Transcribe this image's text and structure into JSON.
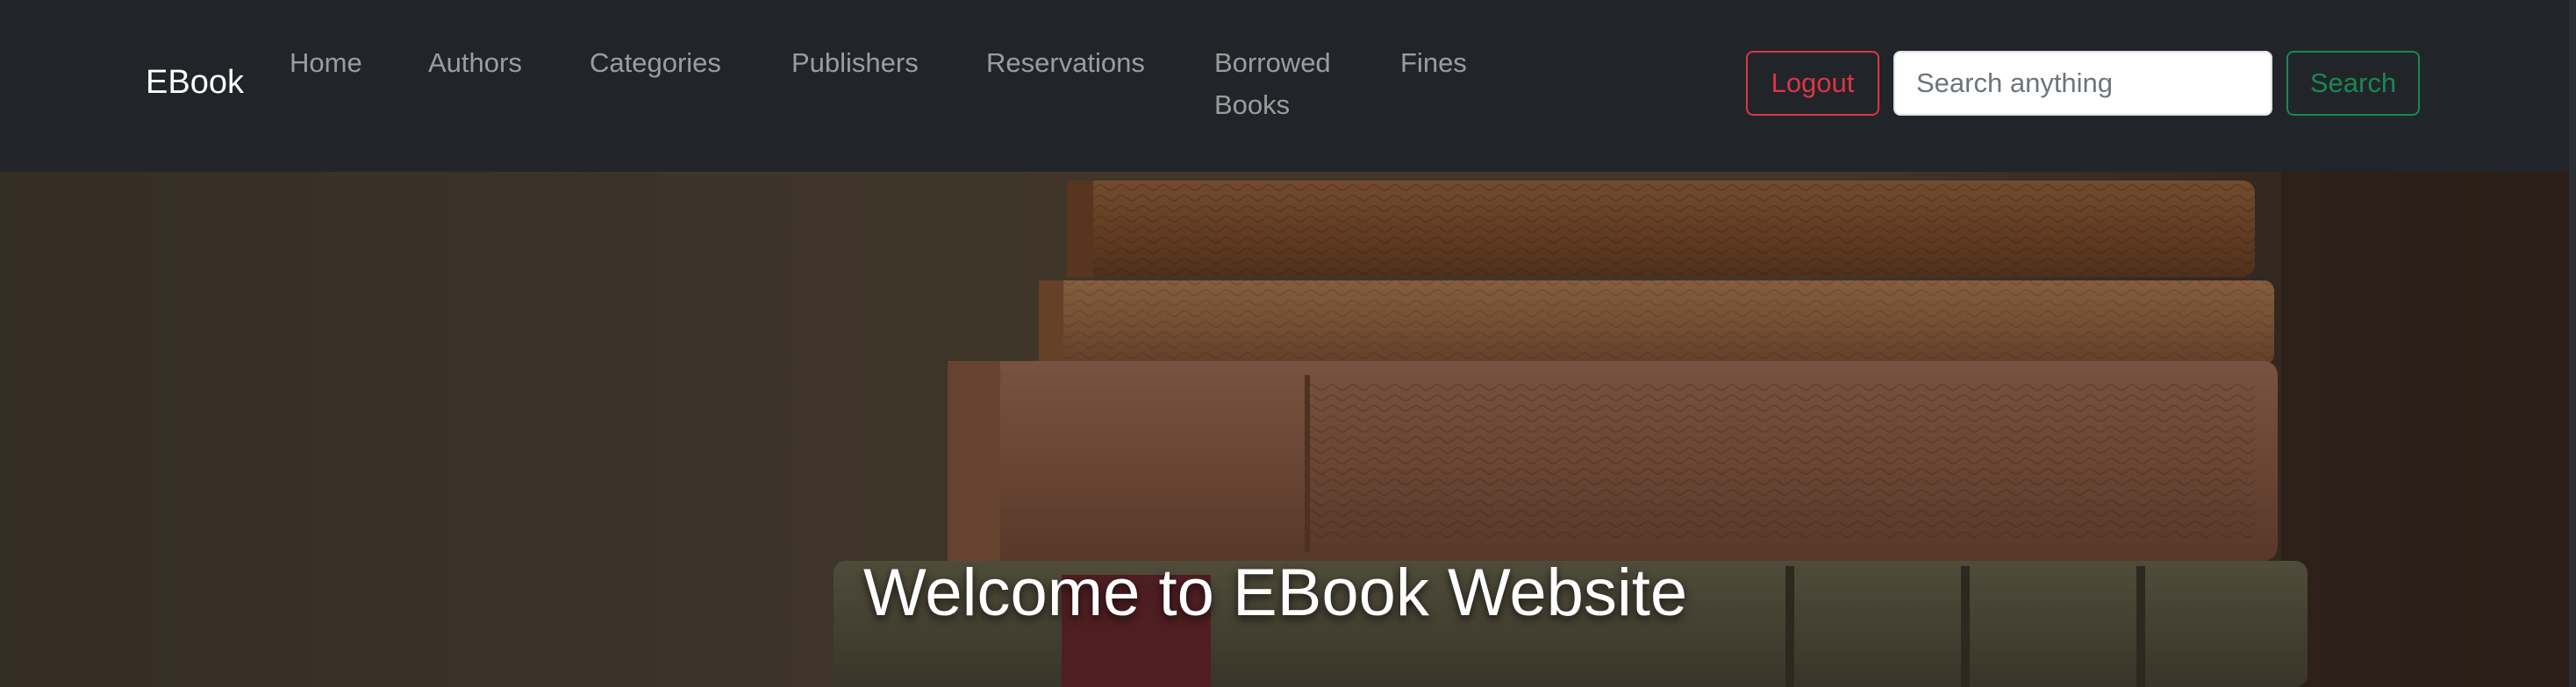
{
  "navbar": {
    "brand": "EBook",
    "links": [
      {
        "label": "Home"
      },
      {
        "label": "Authors"
      },
      {
        "label": "Categories"
      },
      {
        "label": "Publishers"
      },
      {
        "label": "Reservations"
      },
      {
        "label": "Borrowed Books"
      },
      {
        "label": "Fines"
      }
    ],
    "logout_label": "Logout",
    "search_placeholder": "Search anything",
    "search_label": "Search"
  },
  "hero": {
    "title": "Welcome to EBook Website",
    "image_icon": "stacked-books-image"
  },
  "colors": {
    "navbar_bg": "#212529",
    "logout": "#dc3545",
    "search_button": "#198754"
  }
}
